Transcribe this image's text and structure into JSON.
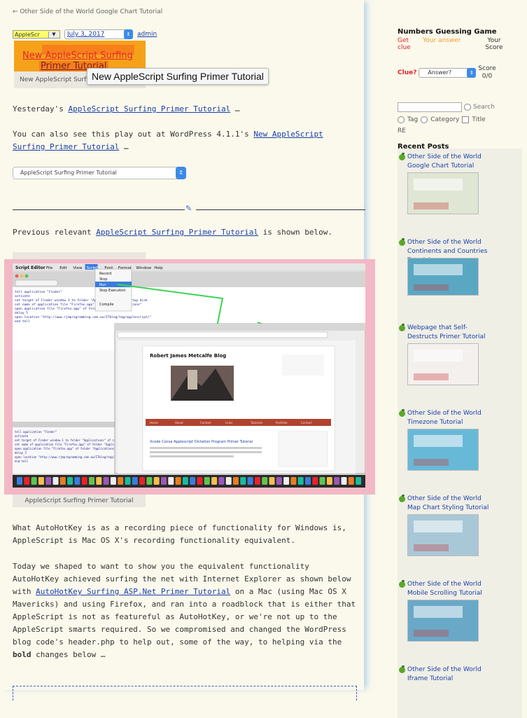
{
  "breadcrumb": "← Other Side of the World Google Chart Tutorial",
  "meta": {
    "category_select": "AppleScr",
    "date_select": "July 3, 2017",
    "author": "admin"
  },
  "overlay": {
    "link_line1": "New AppleScript Surfing",
    "link_line2": "Primer Tutorial",
    "caption": "New AppleScript Surfing Primer Tutorial",
    "tooltip": "New AppleScript Surfing Primer Tutorial"
  },
  "article": {
    "p1_prefix": "Yesterday's ",
    "p1_link": "AppleScript Surfing Primer Tutorial",
    "p1_suffix": " …",
    "p2_prefix": "You can also see this play out at WordPress 4.1.1's ",
    "p2_link": "New AppleScript Surfing Primer Tutorial",
    "p2_suffix": " …",
    "post_select": "AppleScript Surfing Primer Tutorial",
    "p3_prefix": "Previous relevant ",
    "p3_link": "AppleScript Surfing Primer Tutorial",
    "p3_suffix": " is shown below.",
    "image_caption": "AppleScript Surfing Primer Tutorial",
    "p4": "What AutoHotKey is as a recording piece of functionality for Windows is, AppleScript is Mac OS X's recording functionality equivalent.",
    "p5_a": "Today we shaped to want to show you the equivalent functionality AutoHotKey achieved surfing the net with Internet Explorer as shown below with ",
    "p5_link": "AutoHotKey Surfing ASP.Net Primer Tutorial",
    "p5_b": " on a Mac (using Mac OS X Mavericks) and using Firefox, and ran into a roadblock that is either that AppleScript is not as featureful as AutoHotKey, or we're not up to the AppleScript smarts required. So we compromised and changed the WordPress blog code's header.php to help out, some of the way, to helping via the ",
    "p5_bold": "bold",
    "p5_c": " changes below …"
  },
  "screenshot_text": {
    "menubar_app": "Script Editor",
    "menu_items": [
      "File",
      "Edit",
      "View",
      "Script",
      "Font",
      "Format",
      "Window",
      "Help"
    ],
    "script_menu": [
      "Record",
      "Stop",
      "Run",
      "Stop Execution",
      "Compile"
    ],
    "code_lines": [
      "tell application \"Finder\"",
      "  activate",
      "  set target of Finder window 1 to folder \"Applications\" of startup disk",
      "  set name of application file \"Firefox.app\" of folder \"Applications\"",
      "  open application file \"Firefox.app\" of folder \"Applications\"",
      "  delay 5",
      "  open location \"http://www.rjmprogramming.com.au/ITblog/tag/applescript/\"",
      "end tell"
    ],
    "inner_blog_title": "Robert James Metcalfe Blog",
    "inner_post_title": "Xcode Cocoa Applescript Dictation Program Primer Tutorial",
    "inner_menu": [
      "Home",
      "About",
      "Contact",
      "Links",
      "Tutorials",
      "Portfolio",
      "Contact"
    ]
  },
  "sidebar": {
    "game_title": "Numbers Guessing Game",
    "col1": "Get clue",
    "col2": "Your answer",
    "col3": "Your Score",
    "clue_label": "Clue?",
    "answer_placeholder": "Answer?",
    "score_label": "Score",
    "score_value": "0/0",
    "search_label": "Search",
    "filter_tag": "Tag",
    "filter_category": "Category",
    "filter_title": "Title",
    "re_label": "RE",
    "recent_title": "Recent Posts",
    "posts": [
      {
        "title": "Other Side of the World Google Chart Tutorial"
      },
      {
        "title": "Other Side of the World Continents and Countries Tutorial"
      },
      {
        "title": "Webpage that Self-Destructs Primer Tutorial"
      },
      {
        "title": "Other Side of the World Timezone Tutorial"
      },
      {
        "title": "Other Side of the World Map Chart Styling Tutorial"
      },
      {
        "title": "Other Side of the World Mobile Scrolling Tutorial"
      },
      {
        "title": "Other Side of the World Iframe Tutorial"
      }
    ]
  }
}
